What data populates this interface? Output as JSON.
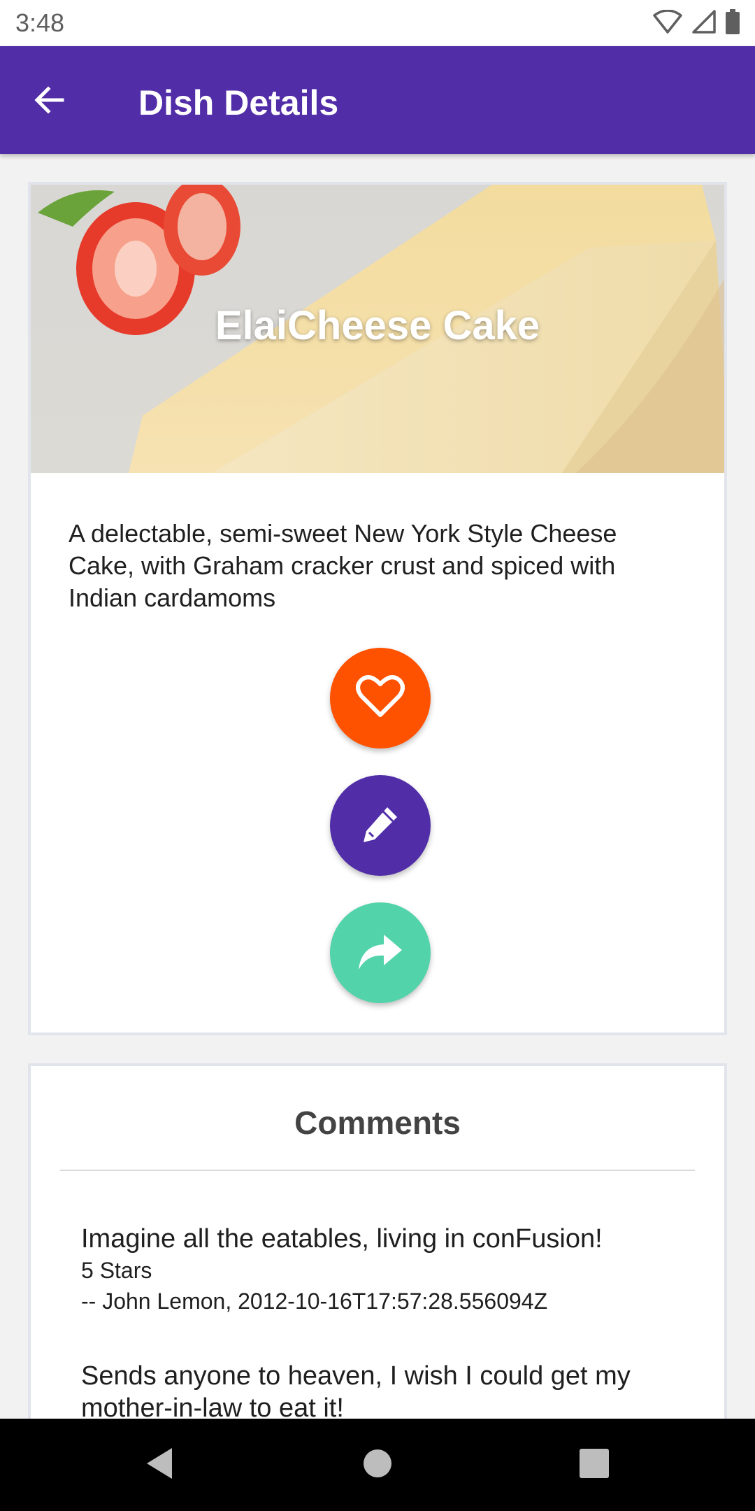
{
  "status_bar": {
    "time": "3:48"
  },
  "app_bar": {
    "title": "Dish Details"
  },
  "dish": {
    "name": "ElaiCheese Cake",
    "description": "A delectable, semi-sweet New York Style Cheese Cake, with Graham cracker crust and spiced with Indian cardamoms",
    "actions": [
      {
        "name": "favorite",
        "icon": "heart-outline-icon",
        "color": "#ff5200"
      },
      {
        "name": "edit",
        "icon": "pencil-icon",
        "color": "#512da8"
      },
      {
        "name": "share",
        "icon": "share-arrow-icon",
        "color": "#52d3aa"
      }
    ]
  },
  "comments": {
    "title": "Comments",
    "items": [
      {
        "text": "Imagine all the eatables, living in conFusion!",
        "rating": "5 Stars",
        "author": "-- John Lemon, 2012-10-16T17:57:28.556094Z"
      },
      {
        "text": "Sends anyone to heaven, I wish I could get my mother-in-law to eat it!",
        "rating": "",
        "author": ""
      }
    ]
  },
  "colors": {
    "primary": "#512da8",
    "favorite": "#ff5200",
    "share": "#52d3aa"
  }
}
